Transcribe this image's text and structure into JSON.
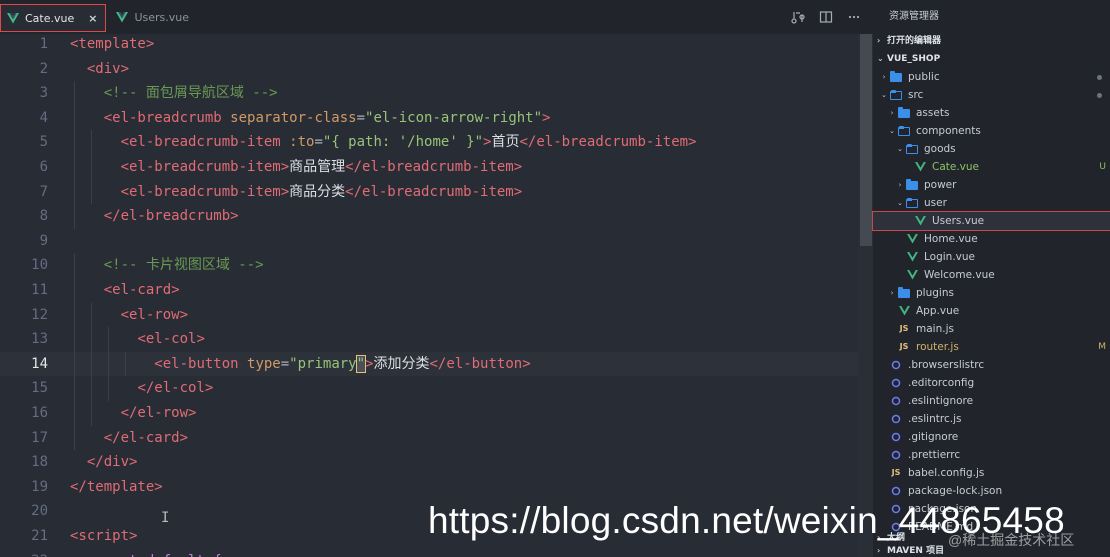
{
  "tabs": [
    {
      "label": "Cate.vue",
      "active": true,
      "close": "×"
    },
    {
      "label": "Users.vue",
      "active": false
    }
  ],
  "explorer": {
    "title": "资源管理器",
    "open_editors": "打开的编辑器",
    "project": "VUE_SHOP",
    "outline": "大纲",
    "maven": "MAVEN 项目",
    "tree": [
      {
        "label": "public",
        "type": "folder",
        "depth": 1,
        "chev": "›"
      },
      {
        "label": "src",
        "type": "folder-open",
        "depth": 1,
        "chev": "⌄"
      },
      {
        "label": "assets",
        "type": "folder",
        "depth": 2,
        "chev": "›"
      },
      {
        "label": "components",
        "type": "folder-open",
        "depth": 2,
        "chev": "⌄"
      },
      {
        "label": "goods",
        "type": "folder-open",
        "depth": 3,
        "chev": "⌄"
      },
      {
        "label": "Cate.vue",
        "type": "vue",
        "depth": 4,
        "badge": "U"
      },
      {
        "label": "power",
        "type": "folder",
        "depth": 3,
        "chev": "›"
      },
      {
        "label": "user",
        "type": "folder-open",
        "depth": 3,
        "chev": "⌄"
      },
      {
        "label": "Users.vue",
        "type": "vue",
        "depth": 4,
        "selected": true
      },
      {
        "label": "Home.vue",
        "type": "vue",
        "depth": 3
      },
      {
        "label": "Login.vue",
        "type": "vue",
        "depth": 3
      },
      {
        "label": "Welcome.vue",
        "type": "vue",
        "depth": 3
      },
      {
        "label": "plugins",
        "type": "folder",
        "depth": 2,
        "chev": "›"
      },
      {
        "label": "App.vue",
        "type": "vue",
        "depth": 2
      },
      {
        "label": "main.js",
        "type": "js",
        "depth": 2
      },
      {
        "label": "router.js",
        "type": "js",
        "depth": 2,
        "badge": "M"
      },
      {
        "label": ".browserslistrc",
        "type": "file",
        "depth": 1
      },
      {
        "label": ".editorconfig",
        "type": "file",
        "depth": 1
      },
      {
        "label": ".eslintignore",
        "type": "file",
        "depth": 1
      },
      {
        "label": ".eslintrc.js",
        "type": "file",
        "depth": 1
      },
      {
        "label": ".gitignore",
        "type": "file",
        "depth": 1
      },
      {
        "label": ".prettierrc",
        "type": "file",
        "depth": 1
      },
      {
        "label": "babel.config.js",
        "type": "js",
        "depth": 1
      },
      {
        "label": "package-lock.json",
        "type": "file",
        "depth": 1
      },
      {
        "label": "package.json",
        "type": "file",
        "depth": 1
      },
      {
        "label": "README.md",
        "type": "file",
        "depth": 1
      }
    ]
  },
  "code": {
    "current_line": 14,
    "lines": [
      {
        "n": "1",
        "html": [
          [
            "tag",
            "<template>"
          ]
        ]
      },
      {
        "n": "2",
        "html": [
          [
            "sp",
            "  "
          ],
          [
            "tag",
            "<div>"
          ]
        ]
      },
      {
        "n": "3",
        "html": [
          [
            "sp",
            "    "
          ],
          [
            "cmt",
            "<!-- 面包屑导航区域 -->"
          ]
        ]
      },
      {
        "n": "4",
        "html": [
          [
            "sp",
            "    "
          ],
          [
            "tag",
            "<el-breadcrumb "
          ],
          [
            "attr",
            "separator-class"
          ],
          [
            "punc",
            "="
          ],
          [
            "str",
            "\"el-icon-arrow-right\""
          ],
          [
            "tag",
            ">"
          ]
        ]
      },
      {
        "n": "5",
        "html": [
          [
            "sp",
            "      "
          ],
          [
            "tag",
            "<el-breadcrumb-item "
          ],
          [
            "attr",
            ":to"
          ],
          [
            "punc",
            "="
          ],
          [
            "str",
            "\"{ path: '/home' }\""
          ],
          [
            "tag",
            ">"
          ],
          [
            "txt",
            "首页"
          ],
          [
            "tag",
            "</el-breadcrumb-item>"
          ]
        ]
      },
      {
        "n": "6",
        "html": [
          [
            "sp",
            "      "
          ],
          [
            "tag",
            "<el-breadcrumb-item>"
          ],
          [
            "txt",
            "商品管理"
          ],
          [
            "tag",
            "</el-breadcrumb-item>"
          ]
        ]
      },
      {
        "n": "7",
        "html": [
          [
            "sp",
            "      "
          ],
          [
            "tag",
            "<el-breadcrumb-item>"
          ],
          [
            "txt",
            "商品分类"
          ],
          [
            "tag",
            "</el-breadcrumb-item>"
          ]
        ]
      },
      {
        "n": "8",
        "html": [
          [
            "sp",
            "    "
          ],
          [
            "tag",
            "</el-breadcrumb>"
          ]
        ]
      },
      {
        "n": "9",
        "html": []
      },
      {
        "n": "10",
        "html": [
          [
            "sp",
            "    "
          ],
          [
            "cmt",
            "<!-- 卡片视图区域 -->"
          ]
        ]
      },
      {
        "n": "11",
        "html": [
          [
            "sp",
            "    "
          ],
          [
            "tag",
            "<el-card>"
          ]
        ]
      },
      {
        "n": "12",
        "html": [
          [
            "sp",
            "      "
          ],
          [
            "tag",
            "<el-row>"
          ]
        ]
      },
      {
        "n": "13",
        "html": [
          [
            "sp",
            "        "
          ],
          [
            "tag",
            "<el-col>"
          ]
        ]
      },
      {
        "n": "14",
        "html": [
          [
            "sp",
            "          "
          ],
          [
            "tag",
            "<el-button "
          ],
          [
            "attr",
            "type"
          ],
          [
            "punc",
            "="
          ],
          [
            "str",
            "\"primary"
          ],
          [
            "cur",
            "\""
          ],
          [
            "tag",
            ">"
          ],
          [
            "txt",
            "添加分类"
          ],
          [
            "tag",
            "</el-button>"
          ]
        ]
      },
      {
        "n": "15",
        "html": [
          [
            "sp",
            "        "
          ],
          [
            "tag",
            "</el-col>"
          ]
        ]
      },
      {
        "n": "16",
        "html": [
          [
            "sp",
            "      "
          ],
          [
            "tag",
            "</el-row>"
          ]
        ]
      },
      {
        "n": "17",
        "html": [
          [
            "sp",
            "    "
          ],
          [
            "tag",
            "</el-card>"
          ]
        ]
      },
      {
        "n": "18",
        "html": [
          [
            "sp",
            "  "
          ],
          [
            "tag",
            "</div>"
          ]
        ]
      },
      {
        "n": "19",
        "html": [
          [
            "tag",
            "</template>"
          ]
        ]
      },
      {
        "n": "20",
        "html": []
      },
      {
        "n": "21",
        "html": [
          [
            "tag",
            "<script>"
          ]
        ]
      },
      {
        "n": "22",
        "html": [
          [
            "sp",
            "  "
          ],
          [
            "kw",
            "export default {"
          ]
        ]
      }
    ]
  },
  "watermark": {
    "url": "https://blog.csdn.net/weixin_44865458",
    "credit": "@稀土掘金技术社区"
  },
  "colors": {
    "editor_bg": "#282c34",
    "tag": "#e06c75",
    "attr": "#d19a66",
    "string": "#98c379",
    "comment": "#6a9955",
    "vue_green": "#41b883",
    "folder_blue": "#3b8eea",
    "selected_outline": "#c9484d"
  }
}
